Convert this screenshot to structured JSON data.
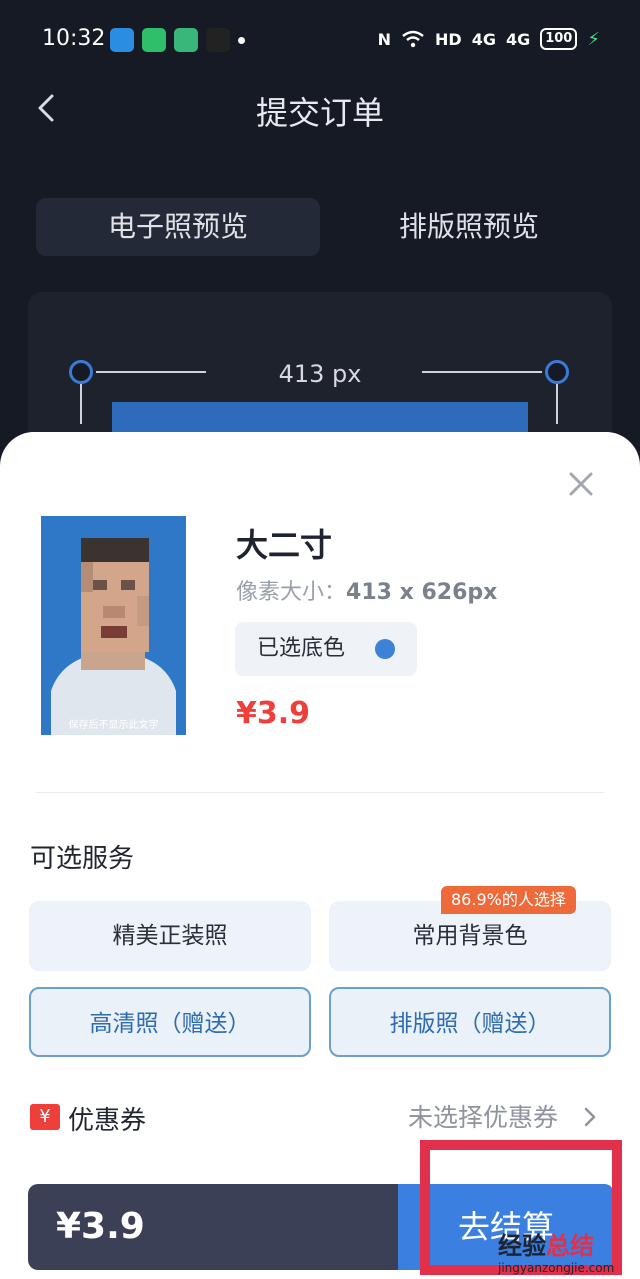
{
  "status_bar": {
    "time": "10:32",
    "network": "HD",
    "signal1": "4G",
    "signal2": "4G",
    "battery": "100"
  },
  "header": {
    "title": "提交订单"
  },
  "tabs": [
    {
      "label": "电子照预览",
      "active": true
    },
    {
      "label": "排版照预览",
      "active": false
    }
  ],
  "preview": {
    "width_label": "413 px",
    "photo_color": "#2f6bbd"
  },
  "product": {
    "name": "大二寸",
    "pixel_label": "像素大小：",
    "pixel_value": "413 x 626px",
    "bg_label": "已选底色",
    "bg_color": "#3d82d6",
    "price": "¥3.9",
    "photo_caption": "保存后不显示此文字"
  },
  "services": {
    "title": "可选服务",
    "items": [
      {
        "label": "精美正装照"
      },
      {
        "label": "常用背景色",
        "badge": "86.9%的人选择"
      },
      {
        "label": "高清照（赠送）"
      },
      {
        "label": "排版照（赠送）"
      }
    ]
  },
  "coupon": {
    "icon_text": "¥",
    "label": "优惠券",
    "value": "未选择优惠券"
  },
  "checkout": {
    "price": "¥3.9",
    "button": "去结算"
  },
  "watermark": {
    "main_a": "经验",
    "main_b": "总结",
    "sub": "jingyanzongjie.com"
  }
}
